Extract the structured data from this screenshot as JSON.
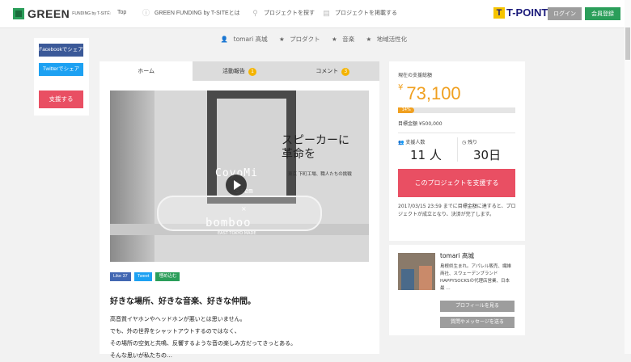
{
  "header": {
    "logo": "GREEN",
    "logo_sub": "FUNDING by T-SITE",
    "nav": [
      {
        "label": "Top",
        "icon": "home-icon"
      },
      {
        "label": "GREEN FUNDING by T-SITEとは",
        "icon": "info-icon"
      },
      {
        "label": "プロジェクトを探す",
        "icon": "search-icon"
      },
      {
        "label": "プロジェクトを掲載する",
        "icon": "document-icon"
      }
    ],
    "tpoint_mark": "T",
    "tpoint": "T-POINT",
    "login": "ログイン",
    "register": "会員登録"
  },
  "tags": [
    "tomari 髙城",
    "プロダクト",
    "音楽",
    "地域活性化"
  ],
  "share": {
    "facebook": "Facebookでシェア",
    "twitter": "Twitterでシェア",
    "support": "支援する"
  },
  "tabs": [
    {
      "label": "ホーム",
      "badge": ""
    },
    {
      "label": "活動報告",
      "badge": "1"
    },
    {
      "label": "コメント",
      "badge": "3"
    }
  ],
  "hero": {
    "title_line1": "スピーカーに",
    "title_line2": "革命を",
    "subtitle": "東京 下町工場、職人たちの挑戦",
    "logo_top": "CoyoMi",
    "logo_mid": "Siem",
    "logo_x": "×",
    "logo_bottom": "bomboo",
    "logo_bottom_sub": "EAST TOKYO MADE"
  },
  "social": {
    "like": "Like 37",
    "tweet": "Tweet",
    "embed": "埋め込む"
  },
  "content": {
    "lead": "好きな場所、好きな音楽、好きな仲間。",
    "lines": [
      "高音質イヤホンやヘッドホンが悪いとは思いません。",
      "でも、外の世界をシャットアウトするのではなく、",
      "その場所の空気と共鳴、反響するような音の楽しみ方だってきっとある。",
      "そんな思いが私たちの…"
    ]
  },
  "funding": {
    "amount_label": "現在の支援総額",
    "currency": "¥",
    "amount": "73,100",
    "progress_label": "14%",
    "progress": 0.14,
    "target": "目標金額 ¥500,000",
    "backers_label": "支援人数",
    "backers": "11 人",
    "days_label": "残り",
    "days": "30日",
    "support_button": "このプロジェクトを支援する",
    "note": "2017/03/15 23:59 までに目標金額に達すると、プロジェクトが成立となり、決済が完了します。"
  },
  "owner": {
    "name": "tomari 髙城",
    "bio": "島根県生まれ。アパレル販売、繊維商社、スウェーデンブランドHAPPYSOCKSの代理店営業、日本最 …",
    "profile_button": "プロフィールを見る",
    "message_button": "質問やメッセージを送る"
  }
}
